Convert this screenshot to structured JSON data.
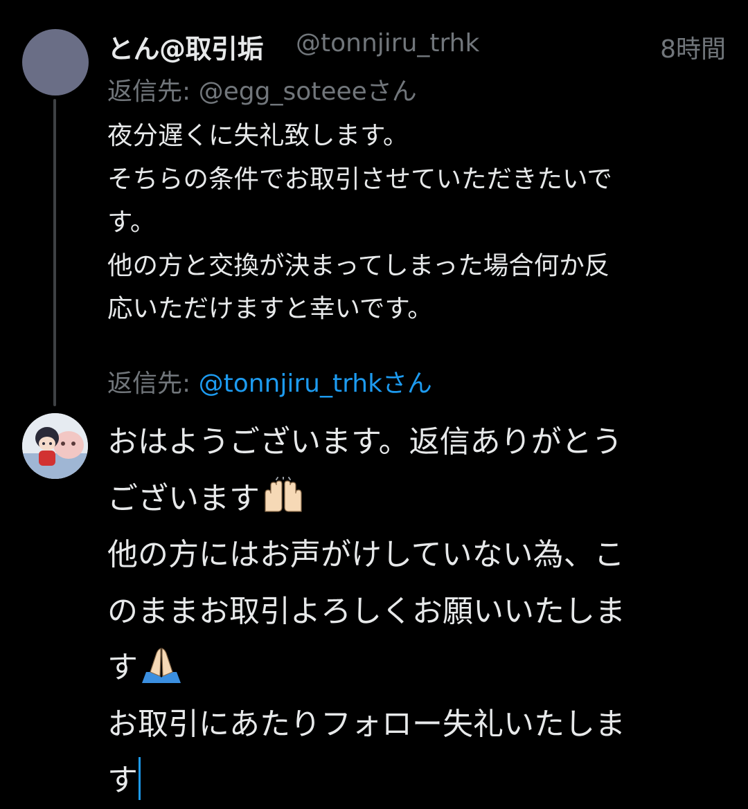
{
  "original_tweet": {
    "display_name": "とん@取引垢",
    "handle": "@tonnjiru_trhk",
    "timestamp": "8時間",
    "reply_to_label": "返信先:",
    "reply_to_handle": "@egg_soteeeさん",
    "body_lines": [
      "夜分遅くに失礼致します。",
      "そちらの条件でお取引させていただきたいで",
      "す。",
      "他の方と交換が決まってしまった場合何か反",
      "応いただけますと幸いです。"
    ]
  },
  "composer": {
    "reply_to_label": "返信先:",
    "reply_to_handle": "@tonnjiru_trhkさん",
    "lines": [
      "おはようございます。返信ありがとう",
      "ございます",
      "他の方にはお声がけしていない為、こ",
      "のままお取引よろしくお願いいたしま",
      "す",
      "お取引にあたりフォロー失礼いたしま",
      "す"
    ],
    "emoji": [
      "raising-hands-emoji",
      "folded-hands-emoji"
    ]
  },
  "colors": {
    "background": "#000000",
    "primary_text": "#e7e9ea",
    "secondary_text": "#71767b",
    "accent": "#1d9bf0",
    "thread_line": "#3e4144"
  }
}
